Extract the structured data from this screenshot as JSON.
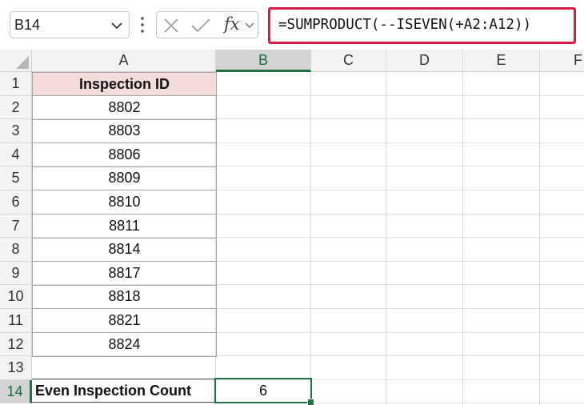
{
  "name_box": {
    "value": "B14"
  },
  "formula_bar": {
    "fx_label": "fx",
    "formula": "=SUMPRODUCT(--ISEVEN(+A2:A12))"
  },
  "columns": [
    "A",
    "B",
    "C",
    "D",
    "E",
    "F"
  ],
  "rows": [
    "1",
    "2",
    "3",
    "4",
    "5",
    "6",
    "7",
    "8",
    "9",
    "10",
    "11",
    "12",
    "13",
    "14"
  ],
  "selected_cell": {
    "column": "B",
    "row": "14"
  },
  "sheet": {
    "header": "Inspection ID",
    "ids": [
      "8802",
      "8803",
      "8806",
      "8809",
      "8810",
      "8811",
      "8814",
      "8817",
      "8818",
      "8821",
      "8824"
    ],
    "label_a14": "Even Inspection Count",
    "result_b14": "6"
  },
  "colors": {
    "formula_highlight": "#d31e4a",
    "header_fill": "#f4dcdb",
    "selection": "#217346"
  }
}
